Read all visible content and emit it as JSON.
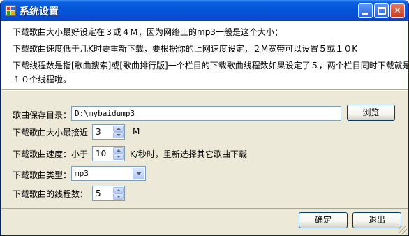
{
  "window": {
    "title": "系统设置",
    "min_glyph": "",
    "max_glyph": "",
    "close_glyph": "✕"
  },
  "info": {
    "line1": "下载歌曲大小最好设定在３或４Ｍ，因为网络上的mp3一般是这个大小；",
    "line2": "下载歌曲速度低于几K时要重新下载，要根据你的上网速度设定，２M宽带可以设置５或１０K",
    "line3": "下载线程数是指[歌曲搜索]或[歌曲排行版]一个栏目的下载歌曲线程数如果设定了５，两个栏目同时下载就是",
    "line4": "１０个线程啦。"
  },
  "form": {
    "save_dir_label": "歌曲保存目录：",
    "save_dir_value": "D:\\mybaidump3",
    "browse_label": "浏览",
    "size_label": "下载歌曲大小最接近",
    "size_value": "3",
    "size_unit": "M",
    "speed_label": "下载歌曲速度：小于",
    "speed_value": "10",
    "speed_unit": "K/秒时，重新选择其它歌曲下载",
    "type_label": "下载歌曲类型：",
    "type_value": "mp3",
    "threads_label": "下载歌曲的线程数：",
    "threads_value": "5"
  },
  "buttons": {
    "ok_label": "确定",
    "exit_label": "退出"
  },
  "icons": {
    "app": "app-icon",
    "minimize": "minimize-icon",
    "maximize": "maximize-icon",
    "close": "close-icon",
    "spin_up": "arrow-up-icon",
    "spin_down": "arrow-down-icon",
    "dropdown": "chevron-down-icon"
  },
  "colors": {
    "titlebar": "#0454d8",
    "window_bg": "#ece9d8",
    "info_bg": "#ffffff",
    "input_border": "#7f9db9"
  }
}
